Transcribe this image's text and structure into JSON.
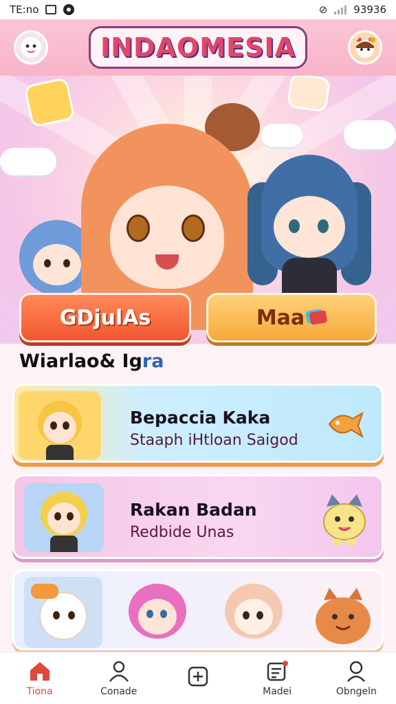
{
  "status_bar": {
    "time": "TE:no",
    "battery_text": "93936"
  },
  "header": {
    "title": "INDAOMESIA",
    "left_avatar": "ghost-face-icon",
    "right_avatar": "fox-mascot-icon"
  },
  "actions": {
    "primary_label": "GDjulAs",
    "secondary_label": "Maa"
  },
  "section": {
    "title_main": "Wiarlao& Ig",
    "title_accent": "ra"
  },
  "cards": [
    {
      "title": "Bepaccia Kaka",
      "subtitle": "Staaph iHtloan Saigod"
    },
    {
      "title": "Rakan Badan",
      "subtitle": "Redbide Unas"
    }
  ],
  "bottom_nav": [
    {
      "label": "Tiona",
      "icon": "home-icon",
      "active": true
    },
    {
      "label": "Conade",
      "icon": "user-icon",
      "active": false
    },
    {
      "label": "",
      "icon": "add-square-icon",
      "active": false
    },
    {
      "label": "Madei",
      "icon": "notes-icon",
      "active": false
    },
    {
      "label": "Obngeln",
      "icon": "profile-icon",
      "active": false
    }
  ],
  "colors": {
    "accent": "#e0483a",
    "header_bg": "#f8b3c8",
    "primary_button": "#f1562f",
    "secondary_button": "#f6a93a"
  }
}
